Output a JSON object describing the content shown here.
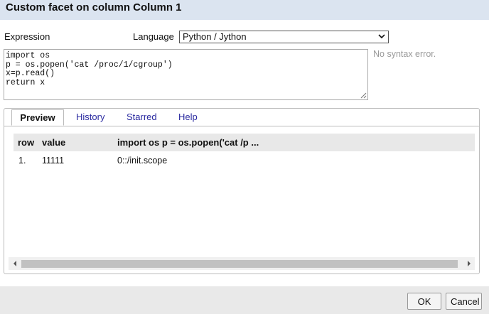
{
  "dialog": {
    "title": "Custom facet on column Column 1"
  },
  "expression": {
    "label": "Expression",
    "language_label": "Language",
    "language_value": "Python / Jython",
    "code_lines": [
      "import os",
      "p = os.popen('cat /proc/1/cgroup')",
      "x=p.read()",
      "return x"
    ],
    "syntax_status": "No syntax error."
  },
  "tabs": [
    {
      "label": "Preview",
      "active": true
    },
    {
      "label": "History",
      "active": false
    },
    {
      "label": "Starred",
      "active": false
    },
    {
      "label": "Help",
      "active": false
    }
  ],
  "preview_table": {
    "headers": [
      "row",
      "value",
      "import os p = os.popen('cat /p ..."
    ],
    "rows": [
      [
        "1.",
        "11111",
        "0::/init.scope"
      ]
    ]
  },
  "footer": {
    "ok_label": "OK",
    "cancel_label": "Cancel"
  },
  "colors": {
    "title_bar": "#dbe4f0",
    "tab_link": "#2a2aa0",
    "footer": "#e9e9e9"
  }
}
